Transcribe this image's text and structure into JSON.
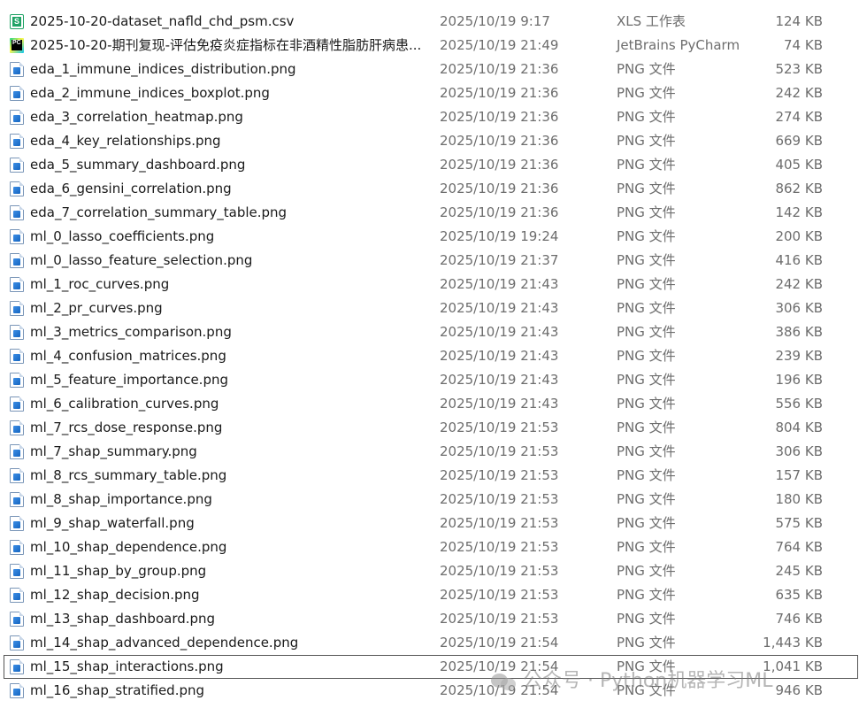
{
  "files": [
    {
      "name": "2025-10-20-dataset_nafld_chd_psm.csv",
      "date": "2025/10/19 9:17",
      "type": "XLS 工作表",
      "size": "124 KB",
      "icon": "xls-icon"
    },
    {
      "name": "2025-10-20-期刊复现-评估免疫炎症指标在非酒精性脂肪肝病患...",
      "date": "2025/10/19 21:49",
      "type": "JetBrains PyCharm",
      "size": "74 KB",
      "icon": "pycharm-icon"
    },
    {
      "name": "eda_1_immune_indices_distribution.png",
      "date": "2025/10/19 21:36",
      "type": "PNG 文件",
      "size": "523 KB",
      "icon": "png-icon"
    },
    {
      "name": "eda_2_immune_indices_boxplot.png",
      "date": "2025/10/19 21:36",
      "type": "PNG 文件",
      "size": "242 KB",
      "icon": "png-icon"
    },
    {
      "name": "eda_3_correlation_heatmap.png",
      "date": "2025/10/19 21:36",
      "type": "PNG 文件",
      "size": "274 KB",
      "icon": "png-icon"
    },
    {
      "name": "eda_4_key_relationships.png",
      "date": "2025/10/19 21:36",
      "type": "PNG 文件",
      "size": "669 KB",
      "icon": "png-icon"
    },
    {
      "name": "eda_5_summary_dashboard.png",
      "date": "2025/10/19 21:36",
      "type": "PNG 文件",
      "size": "405 KB",
      "icon": "png-icon"
    },
    {
      "name": "eda_6_gensini_correlation.png",
      "date": "2025/10/19 21:36",
      "type": "PNG 文件",
      "size": "862 KB",
      "icon": "png-icon"
    },
    {
      "name": "eda_7_correlation_summary_table.png",
      "date": "2025/10/19 21:36",
      "type": "PNG 文件",
      "size": "142 KB",
      "icon": "png-icon"
    },
    {
      "name": "ml_0_lasso_coefficients.png",
      "date": "2025/10/19 19:24",
      "type": "PNG 文件",
      "size": "200 KB",
      "icon": "png-icon"
    },
    {
      "name": "ml_0_lasso_feature_selection.png",
      "date": "2025/10/19 21:37",
      "type": "PNG 文件",
      "size": "416 KB",
      "icon": "png-icon"
    },
    {
      "name": "ml_1_roc_curves.png",
      "date": "2025/10/19 21:43",
      "type": "PNG 文件",
      "size": "242 KB",
      "icon": "png-icon"
    },
    {
      "name": "ml_2_pr_curves.png",
      "date": "2025/10/19 21:43",
      "type": "PNG 文件",
      "size": "306 KB",
      "icon": "png-icon"
    },
    {
      "name": "ml_3_metrics_comparison.png",
      "date": "2025/10/19 21:43",
      "type": "PNG 文件",
      "size": "386 KB",
      "icon": "png-icon"
    },
    {
      "name": "ml_4_confusion_matrices.png",
      "date": "2025/10/19 21:43",
      "type": "PNG 文件",
      "size": "239 KB",
      "icon": "png-icon"
    },
    {
      "name": "ml_5_feature_importance.png",
      "date": "2025/10/19 21:43",
      "type": "PNG 文件",
      "size": "196 KB",
      "icon": "png-icon"
    },
    {
      "name": "ml_6_calibration_curves.png",
      "date": "2025/10/19 21:43",
      "type": "PNG 文件",
      "size": "556 KB",
      "icon": "png-icon"
    },
    {
      "name": "ml_7_rcs_dose_response.png",
      "date": "2025/10/19 21:53",
      "type": "PNG 文件",
      "size": "804 KB",
      "icon": "png-icon"
    },
    {
      "name": "ml_7_shap_summary.png",
      "date": "2025/10/19 21:53",
      "type": "PNG 文件",
      "size": "306 KB",
      "icon": "png-icon"
    },
    {
      "name": "ml_8_rcs_summary_table.png",
      "date": "2025/10/19 21:53",
      "type": "PNG 文件",
      "size": "157 KB",
      "icon": "png-icon"
    },
    {
      "name": "ml_8_shap_importance.png",
      "date": "2025/10/19 21:53",
      "type": "PNG 文件",
      "size": "180 KB",
      "icon": "png-icon"
    },
    {
      "name": "ml_9_shap_waterfall.png",
      "date": "2025/10/19 21:53",
      "type": "PNG 文件",
      "size": "575 KB",
      "icon": "png-icon"
    },
    {
      "name": "ml_10_shap_dependence.png",
      "date": "2025/10/19 21:53",
      "type": "PNG 文件",
      "size": "764 KB",
      "icon": "png-icon"
    },
    {
      "name": "ml_11_shap_by_group.png",
      "date": "2025/10/19 21:53",
      "type": "PNG 文件",
      "size": "245 KB",
      "icon": "png-icon"
    },
    {
      "name": "ml_12_shap_decision.png",
      "date": "2025/10/19 21:53",
      "type": "PNG 文件",
      "size": "635 KB",
      "icon": "png-icon"
    },
    {
      "name": "ml_13_shap_dashboard.png",
      "date": "2025/10/19 21:53",
      "type": "PNG 文件",
      "size": "746 KB",
      "icon": "png-icon"
    },
    {
      "name": "ml_14_shap_advanced_dependence.png",
      "date": "2025/10/19 21:54",
      "type": "PNG 文件",
      "size": "1,443 KB",
      "icon": "png-icon"
    },
    {
      "name": "ml_15_shap_interactions.png",
      "date": "2025/10/19 21:54",
      "type": "PNG 文件",
      "size": "1,041 KB",
      "icon": "png-icon",
      "focused": true
    },
    {
      "name": "ml_16_shap_stratified.png",
      "date": "2025/10/19 21:54",
      "type": "PNG 文件",
      "size": "946 KB",
      "icon": "png-icon"
    }
  ],
  "watermark": {
    "text": "公众号 · Python机器学习ML",
    "icon": "wechat-logo-icon"
  },
  "colors": {
    "text_primary": "#1a1a1a",
    "text_secondary": "#6d6d6d",
    "focus_outline": "#555555"
  }
}
